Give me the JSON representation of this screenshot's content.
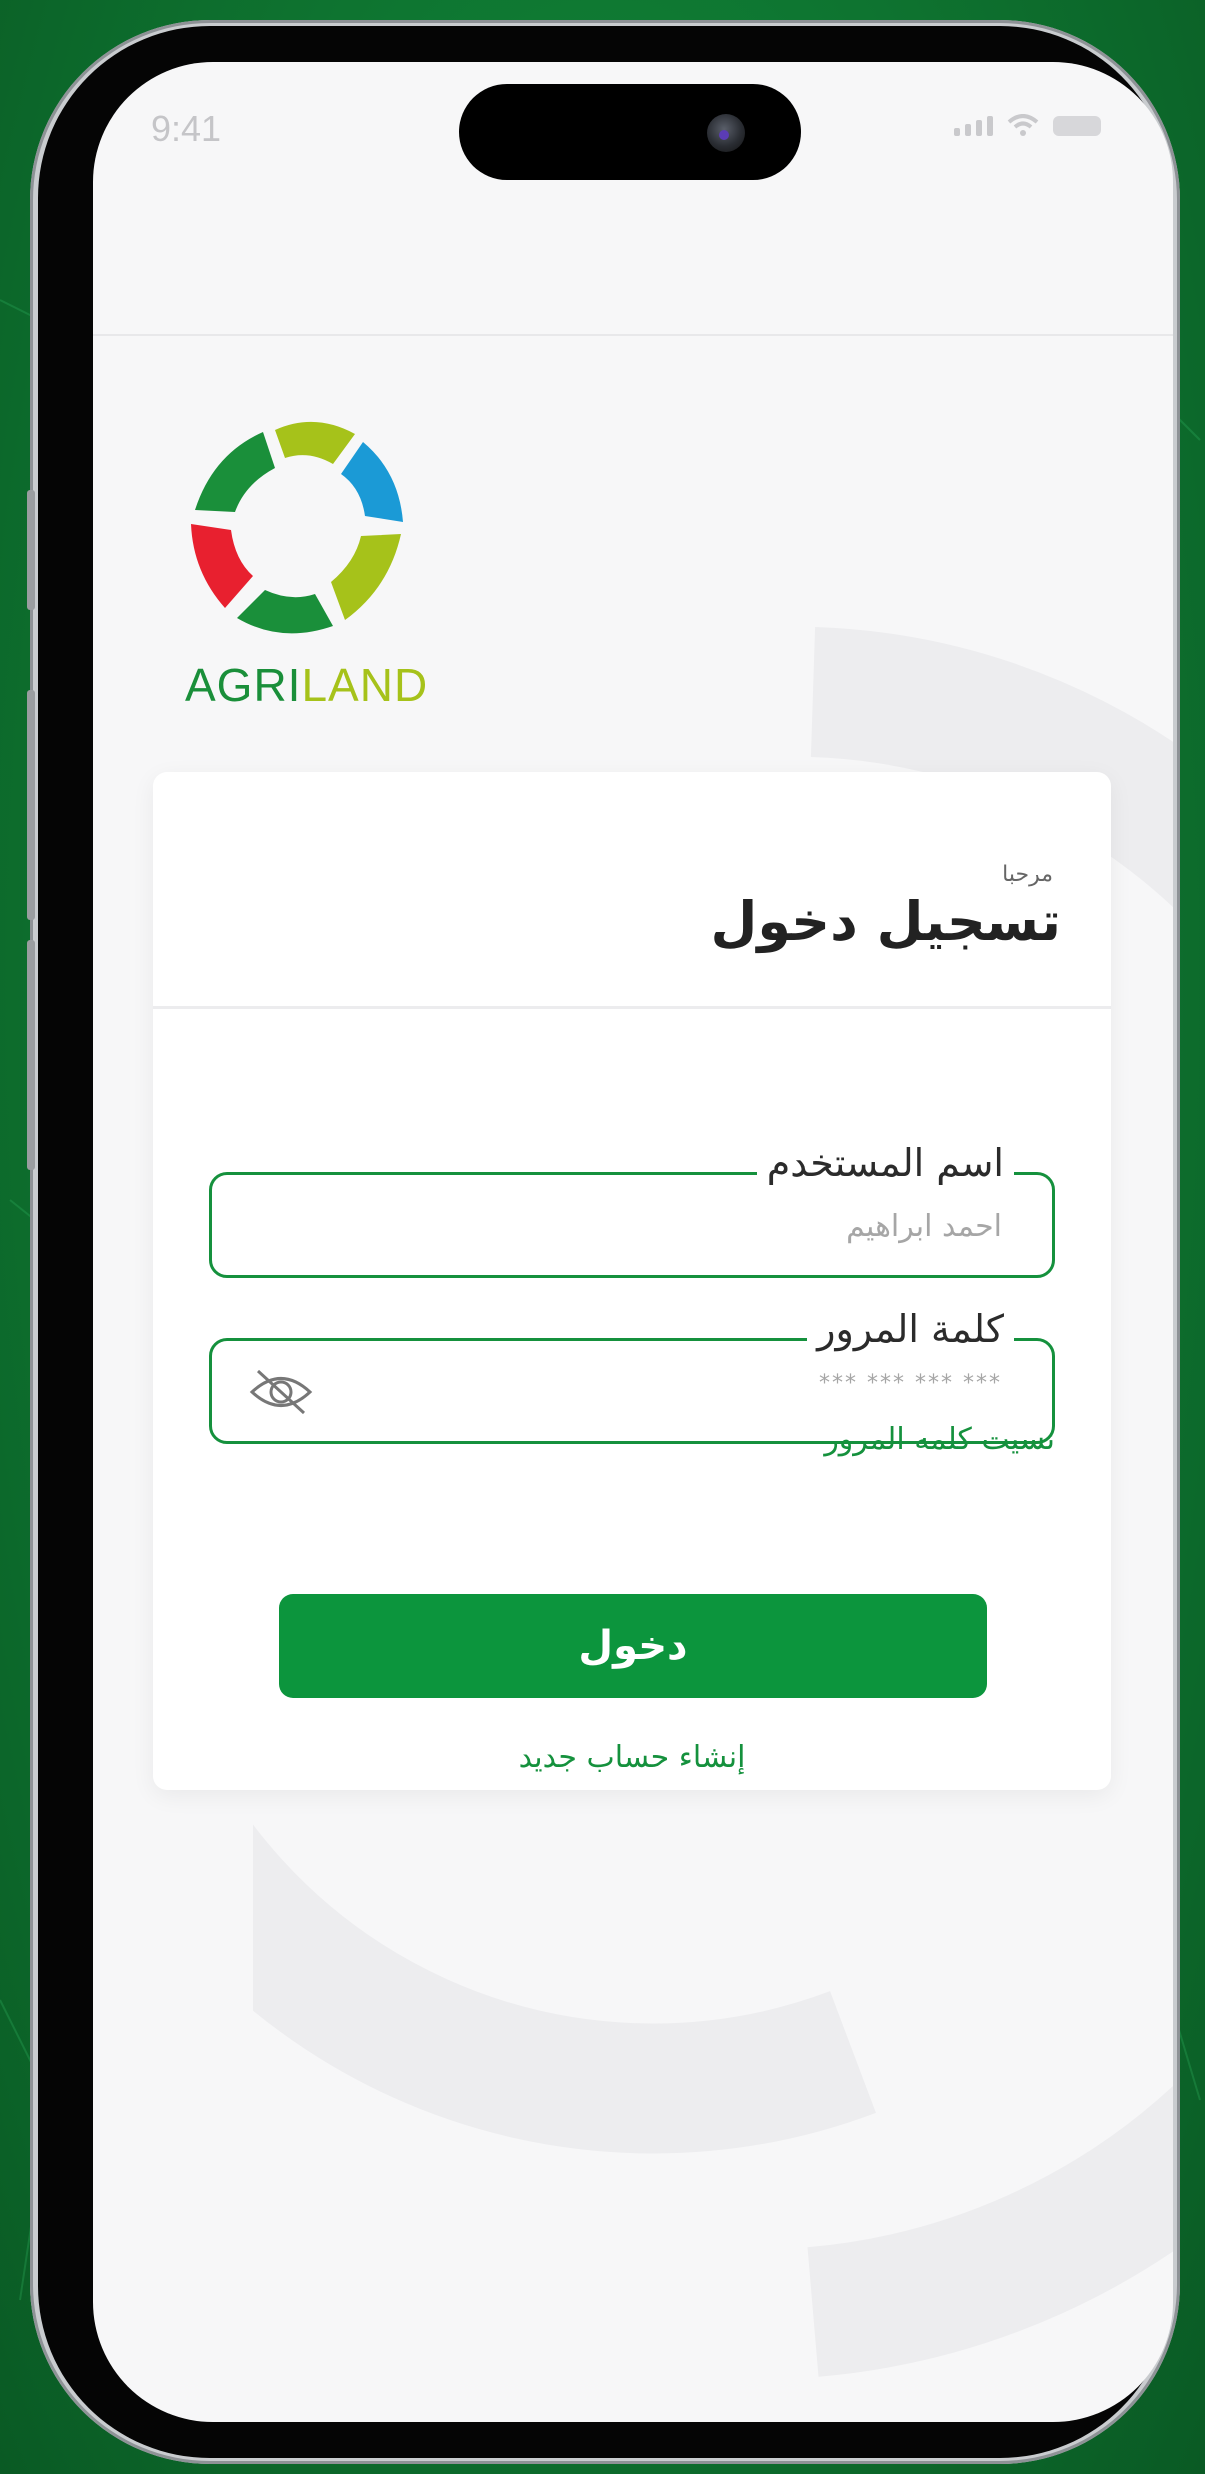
{
  "status_bar": {
    "time": "9:41"
  },
  "logo": {
    "text_part1": "AGRI",
    "text_part2": "LAND"
  },
  "login_card": {
    "greeting": "مرحبا",
    "title": "تسجيل دخول",
    "username_field": {
      "label": "اسم المستخدم",
      "value": "احمد ابراهيم"
    },
    "password_field": {
      "label": "كلمة المرور",
      "value": "*** *** *** ***"
    },
    "forgot_password": "نسيت كلمه المرور",
    "login_button": "دخول",
    "create_account": "إنشاء حساب جديد"
  },
  "colors": {
    "primary": "#0c953d",
    "background": "#0f7a33",
    "screen": "#f7f7f8"
  }
}
